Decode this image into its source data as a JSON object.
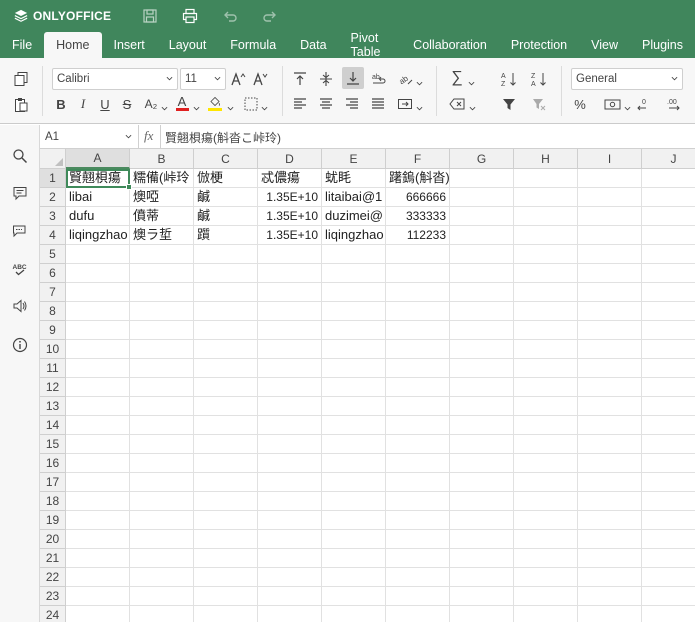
{
  "app": {
    "logo_text": "ONLYOFFICE",
    "brand_color": "#40865c"
  },
  "quick_access": [
    {
      "name": "save-icon"
    },
    {
      "name": "print-icon"
    },
    {
      "name": "undo-icon"
    },
    {
      "name": "redo-icon"
    }
  ],
  "tabs": [
    {
      "label": "File",
      "active": false
    },
    {
      "label": "Home",
      "active": true
    },
    {
      "label": "Insert",
      "active": false
    },
    {
      "label": "Layout",
      "active": false
    },
    {
      "label": "Formula",
      "active": false
    },
    {
      "label": "Data",
      "active": false
    },
    {
      "label": "Pivot Table",
      "active": false
    },
    {
      "label": "Collaboration",
      "active": false
    },
    {
      "label": "Protection",
      "active": false
    },
    {
      "label": "View",
      "active": false
    },
    {
      "label": "Plugins",
      "active": false
    }
  ],
  "toolbar": {
    "font_name": "Calibri",
    "font_size": "11",
    "number_format": "General",
    "bold_label": "B",
    "italic_label": "I",
    "underline_label": "U",
    "strike_label": "S",
    "subscript_label": "A₂",
    "font_color_label": "A",
    "font_color": "#e02020",
    "fill_color": "#ffe600",
    "percent_label": "%",
    "sigma_label": "∑"
  },
  "formula_bar": {
    "cell_ref": "A1",
    "fx_label": "fx",
    "content": "賢翹梖瘍(斛沓こ峠玲)"
  },
  "sheet": {
    "columns": [
      "A",
      "B",
      "C",
      "D",
      "E",
      "F",
      "G",
      "H",
      "I",
      "J"
    ],
    "selected_column": "A",
    "selected_row": 1,
    "row_numbers": [
      "1",
      "2",
      "3",
      "4",
      "5",
      "6",
      "7",
      "8",
      "9",
      "10",
      "11",
      "12",
      "13",
      "14",
      "15",
      "16",
      "17",
      "18",
      "19",
      "20",
      "21",
      "22",
      "23",
      "24"
    ],
    "rows": [
      [
        "賢翹梖瘍",
        "糯備(峠玲",
        "倣梗",
        "忒儂瘍",
        "蚘眊",
        "躇鎢(斛沓)"
      ],
      [
        "libai",
        "燠啞",
        "鹹",
        "1.35E+10",
        "litaibai@1",
        "666666"
      ],
      [
        "dufu",
        "僨蒂",
        "鹹",
        "1.35E+10",
        "duzimei@",
        "333333"
      ],
      [
        "liqingzhao",
        "燠ラ埑",
        "躓",
        "1.35E+10",
        "liqingzhao",
        "112233"
      ]
    ]
  }
}
